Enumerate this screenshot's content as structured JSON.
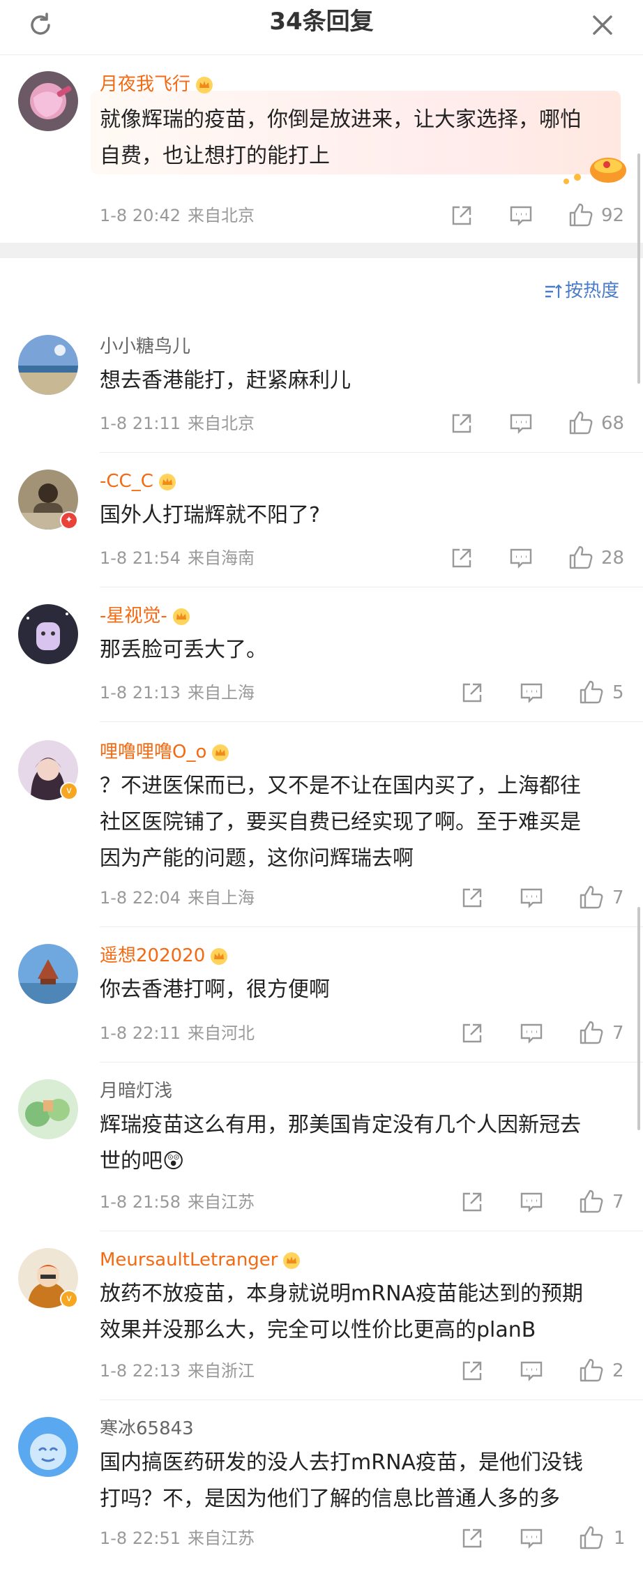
{
  "header": {
    "title": "34条回复",
    "refresh_icon": "refresh-icon",
    "close_icon": "close-icon"
  },
  "sort": {
    "label": "按热度",
    "icon": "sort-icon"
  },
  "top_comment": {
    "name": "月夜我飞行",
    "text_line1": "就像辉瑞的疫苗，你倒是放进来，让大家选择，哪怕",
    "text_line2": "自费，也让想打的能打上",
    "time": "1-8 20:42",
    "location": "来自北京",
    "likes": "92"
  },
  "replies": [
    {
      "name": "小小糖鸟儿",
      "vip": false,
      "lines": [
        "想去香港能打，赶紧麻利儿"
      ],
      "time": "1-8 21:11",
      "location": "来自北京",
      "likes": "68"
    },
    {
      "name": "-CC_C",
      "vip": true,
      "lines": [
        "国外人打瑞辉就不阳了?"
      ],
      "time": "1-8 21:54",
      "location": "来自海南",
      "likes": "28"
    },
    {
      "name": "-星视觉-",
      "vip": true,
      "lines": [
        "那丢脸可丢大了。"
      ],
      "time": "1-8 21:13",
      "location": "来自上海",
      "likes": "5"
    },
    {
      "name": "哩噜哩噜O_o",
      "vip": true,
      "lines": [
        "？不进医保而已，又不是不让在国内买了，上海都往",
        "社区医院铺了，要买自费已经实现了啊。至于难买是",
        "因为产能的问题，这你问辉瑞去啊"
      ],
      "time": "1-8 22:04",
      "location": "来自上海",
      "likes": "7"
    },
    {
      "name": "遥想202020",
      "vip": true,
      "lines": [
        "你去香港打啊，很方便啊"
      ],
      "time": "1-8 22:11",
      "location": "来自河北",
      "likes": "7"
    },
    {
      "name": "月暗灯浅",
      "vip": false,
      "lines": [
        "辉瑞疫苗这么有用，那美国肯定没有几个人因新冠去",
        "世的吧😲"
      ],
      "time": "1-8 21:58",
      "location": "来自江苏",
      "likes": "7"
    },
    {
      "name": "MeursaultLetranger",
      "vip": true,
      "lines": [
        "放药不放疫苗，本身就说明mRNA疫苗能达到的预期",
        "效果并没那么大，完全可以性价比更高的planB"
      ],
      "time": "1-8 22:13",
      "location": "来自浙江",
      "likes": "2"
    },
    {
      "name": "寒冰65843",
      "vip": false,
      "lines": [
        "国内搞医药研发的没人去打mRNA疫苗，是他们没钱",
        "打吗？不，是因为他们了解的信息比普通人多的多"
      ],
      "time": "1-8 22:51",
      "location": "来自江苏",
      "likes": "1"
    }
  ],
  "colors": {
    "vip_name": "#f46a12",
    "plain_name": "#666666",
    "meta": "#999999",
    "sort": "#4a7cc9"
  }
}
